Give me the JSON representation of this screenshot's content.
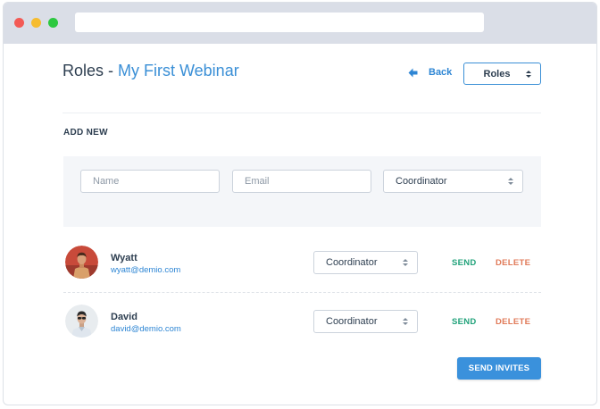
{
  "header": {
    "title_prefix": "Roles - ",
    "title_accent": "My First Webinar",
    "back_label": "Back",
    "roles_select": "Roles"
  },
  "add_new": {
    "label": "ADD NEW",
    "name_placeholder": "Name",
    "email_placeholder": "Email",
    "role_value": "Coordinator"
  },
  "users": [
    {
      "name": "Wyatt",
      "email": "wyatt@demio.com",
      "role": "Coordinator",
      "send_label": "SEND",
      "delete_label": "DELETE"
    },
    {
      "name": "David",
      "email": "david@demio.com",
      "role": "Coordinator",
      "send_label": "SEND",
      "delete_label": "DELETE"
    }
  ],
  "actions": {
    "send_invites": "SEND INVITES"
  },
  "colors": {
    "accent": "#3a8fd6",
    "send": "#20a27a",
    "delete": "#e07a58",
    "text": "#2d3e50"
  }
}
